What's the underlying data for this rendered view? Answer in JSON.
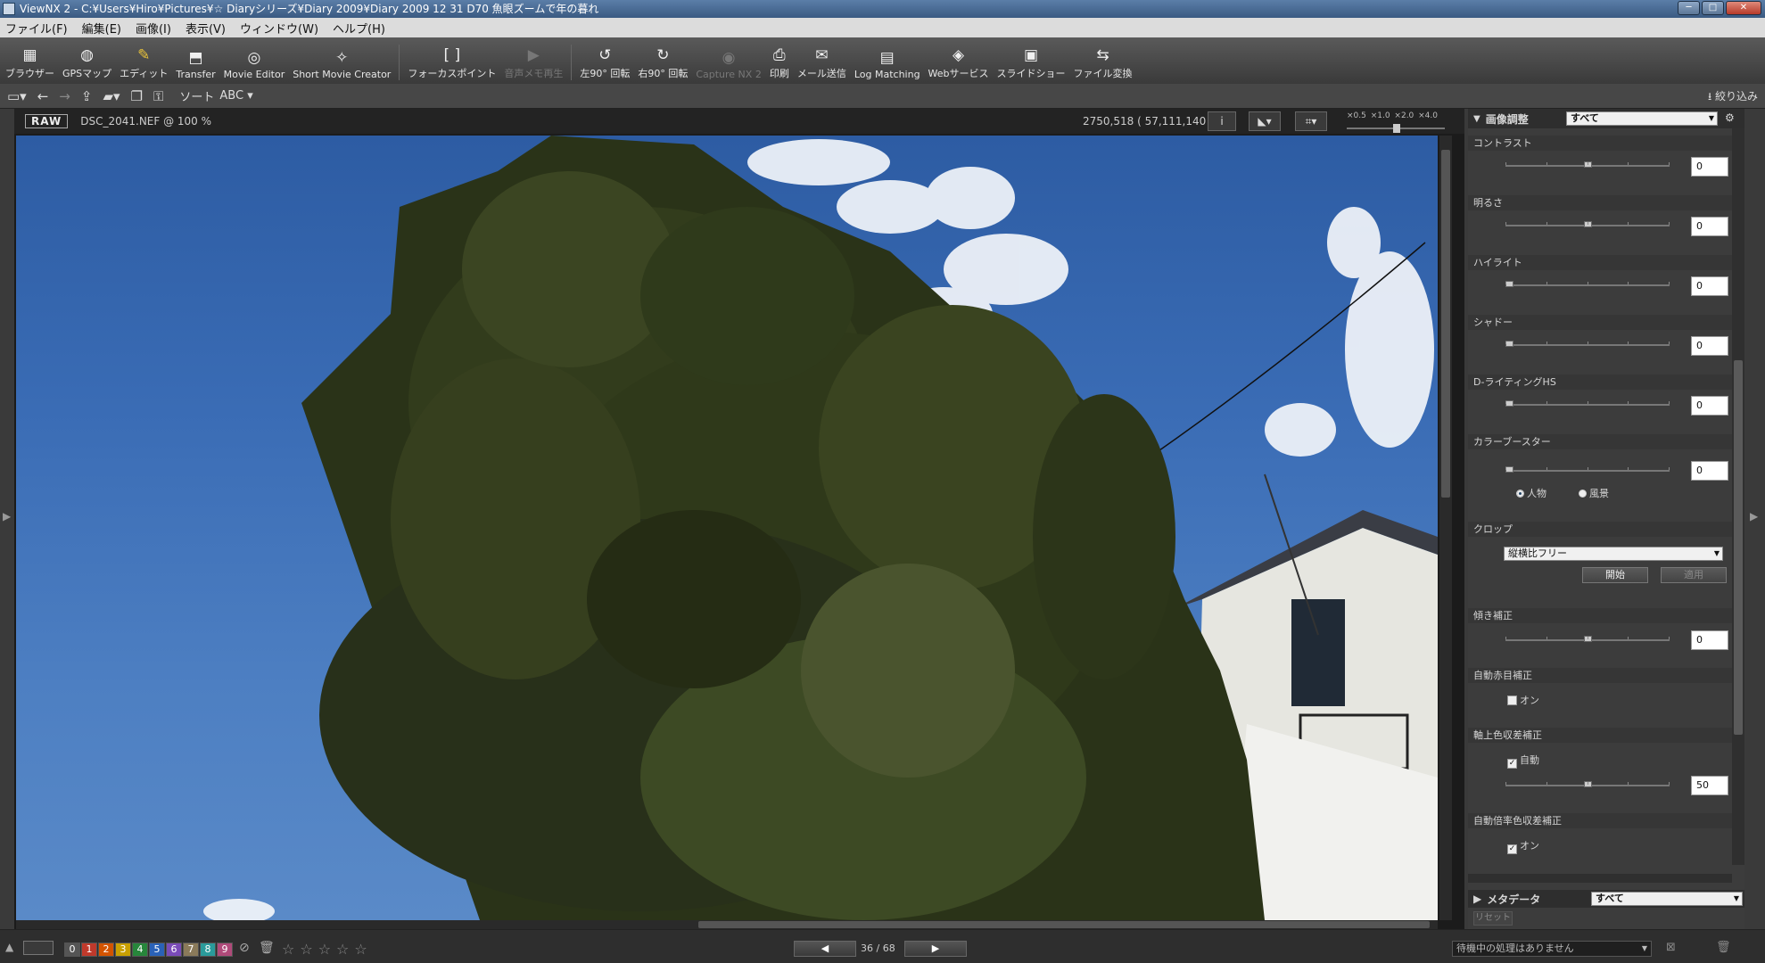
{
  "window": {
    "title": "ViewNX 2 - C:¥Users¥Hiro¥Pictures¥☆ Diaryシリーズ¥Diary 2009¥Diary 2009 12 31 D70 魚眼ズームで年の暮れ",
    "minimize": "─",
    "maximize": "□",
    "close": "✕"
  },
  "menu": [
    "ファイル(F)",
    "編集(E)",
    "画像(I)",
    "表示(V)",
    "ウィンドウ(W)",
    "ヘルプ(H)"
  ],
  "toolbar": {
    "browser": "ブラウザー",
    "gps": "GPSマップ",
    "edit": "エディット",
    "transfer": "Transfer",
    "movie_editor": "Movie Editor",
    "short_movie": "Short Movie Creator",
    "focus_point": "フォーカスポイント",
    "audio": "音声メモ再生",
    "rot_left": "左90°",
    "rot_left2": "回転",
    "rot_right": "右90°",
    "rot_right2": "回転",
    "capture": "Capture NX 2",
    "print": "印刷",
    "mail": "メール送信",
    "log": "Log Matching",
    "web": "Webサービス",
    "slideshow": "スライドショー",
    "convert": "ファイル変換"
  },
  "toolbar2": {
    "sort": "ソート",
    "sort_mode": "ABC",
    "filter": "絞り込み"
  },
  "viewer": {
    "raw_badge": "RAW",
    "filename": "DSC_2041.NEF @ 100 %",
    "coords": "2750,518 ( 57,111,140 )",
    "info_icon": "i",
    "zoom_labels": "×0.5 ×1.0 ×2.0 ×4.0"
  },
  "adjust": {
    "title": "画像調整",
    "preset": "すべて",
    "contrast": {
      "label": "コントラスト",
      "value": "0",
      "level": 0.5
    },
    "brightness": {
      "label": "明るさ",
      "value": "0",
      "level": 0.5
    },
    "highlight": {
      "label": "ハイライト",
      "value": "0",
      "level": 0
    },
    "shadow": {
      "label": "シャドー",
      "value": "0",
      "level": 0
    },
    "dlighting": {
      "label": "D-ライティングHS",
      "value": "0",
      "level": 0
    },
    "booster": {
      "label": "カラーブースター",
      "value": "0",
      "level": 0
    },
    "booster_people": "人物",
    "booster_scenery": "風景",
    "crop": {
      "label": "クロップ",
      "ratio": "縦横比フリー",
      "start": "開始",
      "apply": "適用"
    },
    "tilt": {
      "label": "傾き補正",
      "value": "0",
      "level": 0.5
    },
    "redeye": {
      "label": "自動赤目補正",
      "check": "オン"
    },
    "axial": {
      "label": "軸上色収差補正",
      "check": "自動",
      "value": "50",
      "level": 0.5
    },
    "lateral": {
      "label": "自動倍率色収差補正",
      "check": "オン"
    }
  },
  "metadata": {
    "title": "メタデータ",
    "preset": "すべて",
    "reset": "リセット"
  },
  "status": {
    "labels": [
      "0",
      "1",
      "2",
      "3",
      "4",
      "5",
      "6",
      "7",
      "8",
      "9"
    ],
    "label_colors": [
      "#555555",
      "#c0392b",
      "#d35400",
      "#c9a000",
      "#27863b",
      "#2a62b8",
      "#7a4bb8",
      "#8a7a5a",
      "#2a9b9b",
      "#b04a7a"
    ],
    "rating_stars": 0,
    "page": "36 / 68",
    "process": "待機中の処理はありません"
  }
}
